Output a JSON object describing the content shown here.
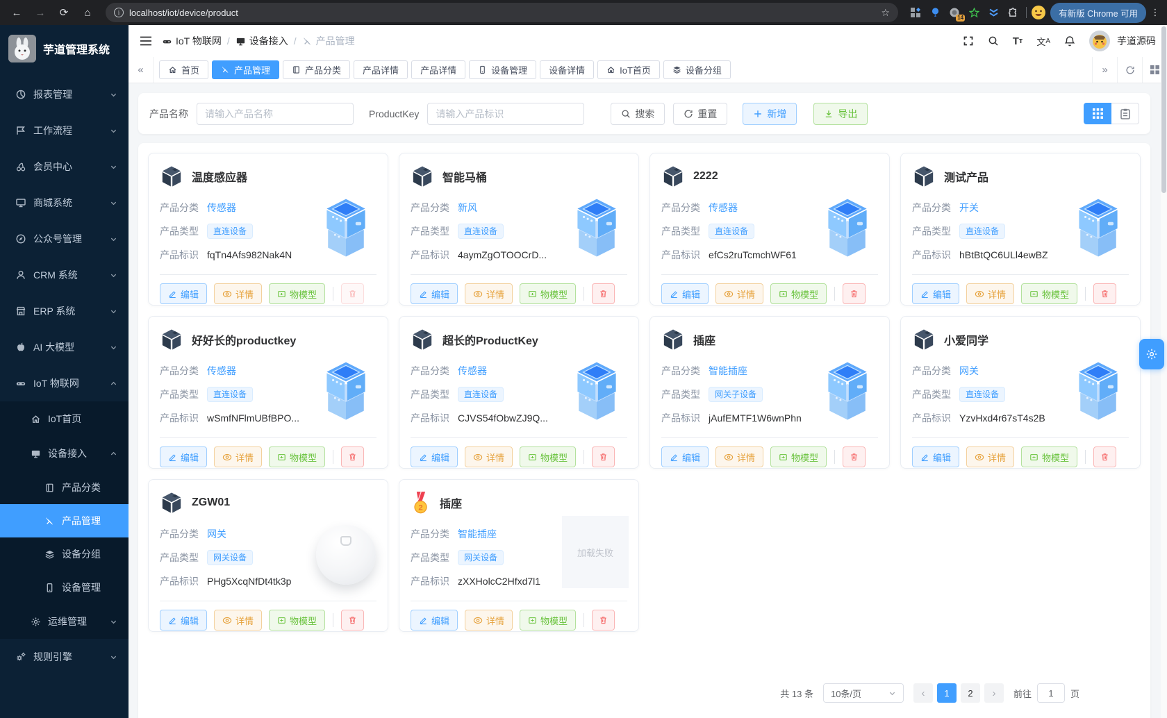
{
  "browser": {
    "url": "localhost/iot/device/product",
    "update_pill": "有新版 Chrome 可用",
    "extension_badge": "14"
  },
  "sidebar": {
    "logo_title": "芋道管理系统",
    "top_items": [
      "报表管理",
      "工作流程",
      "会员中心",
      "商城系统",
      "公众号管理",
      "CRM 系统",
      "ERP 系统",
      "AI 大模型"
    ],
    "iot": {
      "label": "IoT 物联网",
      "home": "IoT首页",
      "access": "设备接入",
      "access_children": [
        "产品分类",
        "产品管理",
        "设备分组",
        "设备管理"
      ],
      "ops": "运维管理"
    },
    "rule": "规则引擎"
  },
  "header": {
    "breadcrumb": [
      "IoT 物联网",
      "设备接入",
      "产品管理"
    ],
    "username": "芋道源码"
  },
  "tabs": [
    {
      "label": "首页",
      "icon": "home",
      "active": false
    },
    {
      "label": "产品管理",
      "icon": "tools",
      "active": true
    },
    {
      "label": "产品分类",
      "icon": "book",
      "active": false
    },
    {
      "label": "产品详情",
      "icon": "",
      "active": false
    },
    {
      "label": "产品详情",
      "icon": "",
      "active": false
    },
    {
      "label": "设备管理",
      "icon": "phone",
      "active": false
    },
    {
      "label": "设备详情",
      "icon": "",
      "active": false
    },
    {
      "label": "IoT首页",
      "icon": "home",
      "active": false
    },
    {
      "label": "设备分组",
      "icon": "layers",
      "active": false
    }
  ],
  "filter": {
    "name_label": "产品名称",
    "name_placeholder": "请输入产品名称",
    "key_label": "ProductKey",
    "key_placeholder": "请输入产品标识",
    "search": "搜索",
    "reset": "重置",
    "add": "新增",
    "export": "导出"
  },
  "card_labels": {
    "category": "产品分类",
    "type": "产品类型",
    "key": "产品标识",
    "edit": "编辑",
    "detail": "详情",
    "model": "物模型"
  },
  "cards": [
    {
      "title": "温度感应器",
      "category": "传感器",
      "type": "直连设备",
      "key": "fqTn4Afs982Nak4N",
      "image": "cube",
      "delete_disabled": true
    },
    {
      "title": "智能马桶",
      "category": "新风",
      "type": "直连设备",
      "key": "4aymZgOTOOCrD...",
      "image": "cube",
      "delete_disabled": false
    },
    {
      "title": "2222",
      "category": "传感器",
      "type": "直连设备",
      "key": "efCs2ruTcmchWF61",
      "image": "cube",
      "delete_disabled": false
    },
    {
      "title": "测试产品",
      "category": "开关",
      "type": "直连设备",
      "key": "hBtBtQC6ULl4ewBZ",
      "image": "cube",
      "delete_disabled": false
    },
    {
      "title": "好好长的productkey",
      "category": "传感器",
      "type": "直连设备",
      "key": "wSmfNFlmUBfBPO...",
      "image": "cube",
      "delete_disabled": false
    },
    {
      "title": "超长的ProductKey",
      "category": "传感器",
      "type": "直连设备",
      "key": "CJVS54fObwZJ9Q...",
      "image": "cube",
      "delete_disabled": false
    },
    {
      "title": "插座",
      "category": "智能插座",
      "type": "网关子设备",
      "key": "jAufEMTF1W6wnPhn",
      "image": "cube",
      "delete_disabled": false
    },
    {
      "title": "小爱同学",
      "category": "网关",
      "type": "直连设备",
      "key": "YzvHxd4r67sT4s2B",
      "image": "cube",
      "delete_disabled": false
    },
    {
      "title": "ZGW01",
      "category": "网关",
      "type": "网关设备",
      "key": "PHg5XcqNfDt4tk3p",
      "image": "device",
      "delete_disabled": false
    },
    {
      "title": "插座",
      "category": "智能插座",
      "type": "网关设备",
      "key": "zXXHolcC2Hfxd7l1",
      "image": "error",
      "error_text": "加载失败",
      "title_icon": "medal",
      "delete_disabled": false
    }
  ],
  "pagination": {
    "total": "共 13 条",
    "per_page": "10条/页",
    "pages": [
      "1",
      "2"
    ],
    "active_page": "1",
    "goto": "前往",
    "goto_value": "1",
    "page_unit": "页"
  },
  "colors": {
    "accent": "#409eff",
    "success": "#67c23a",
    "warning": "#e6a23c",
    "danger": "#f56c6c",
    "sidebar_bg": "#0c2135"
  }
}
